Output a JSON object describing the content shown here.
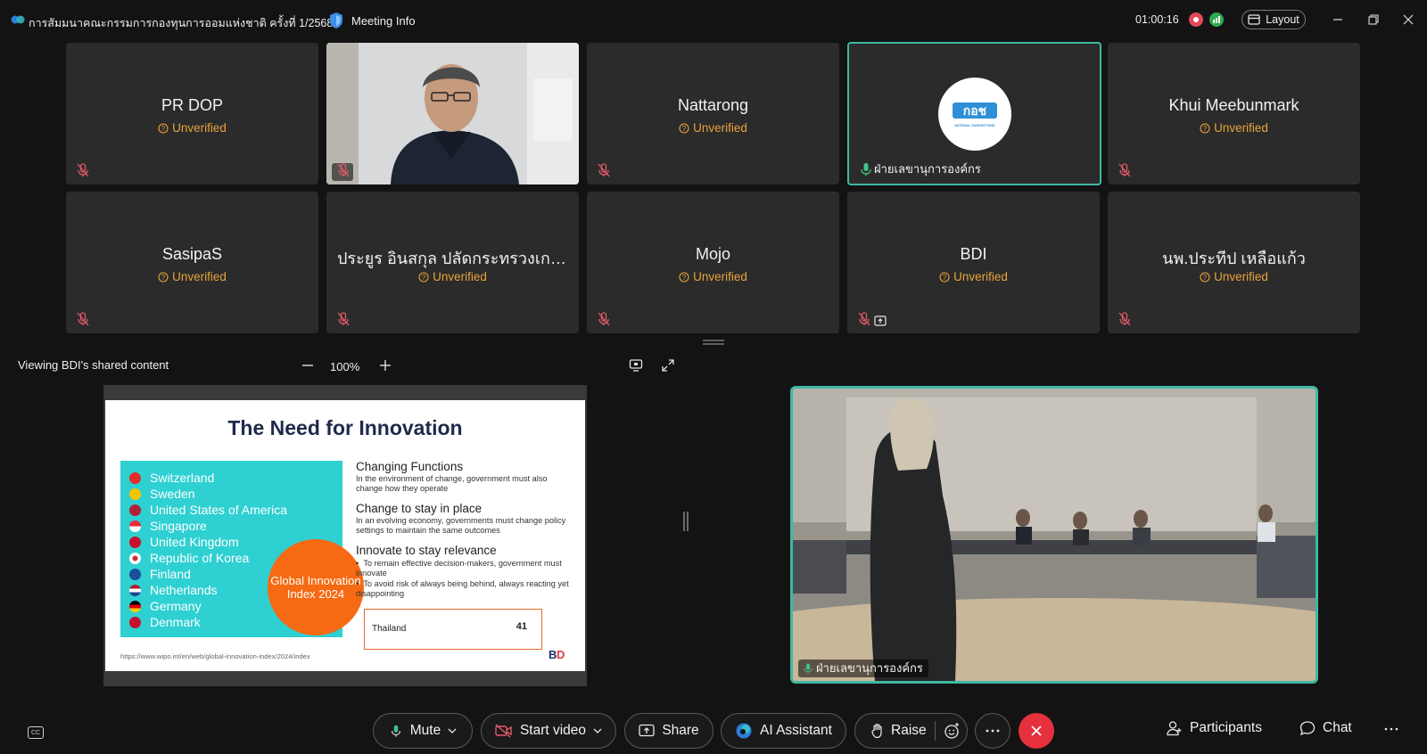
{
  "window": {
    "title": "การสัมมนาคณะกรรมการกองทุนการออมแห่งชาติ ครั้งที่ 1/2568",
    "meeting_info_label": "Meeting Info",
    "timer": "01:00:16",
    "layout_label": "Layout"
  },
  "tiles": [
    {
      "name": "PR DOP",
      "status": "Unverified"
    },
    {
      "name": "",
      "status": ""
    },
    {
      "name": "Nattarong",
      "status": "Unverified"
    },
    {
      "name": "ฝ่ายเลขานุการองค์กร",
      "status": "",
      "logo_text": "NATIONAL SAVINGS FUND"
    },
    {
      "name": "Khui Meebunmark",
      "status": "Unverified"
    },
    {
      "name": "SasipaS",
      "status": "Unverified"
    },
    {
      "name": "ประยูร อินสกุล ปลัดกระทรวงเกษ...",
      "status": "Unverified"
    },
    {
      "name": "Mojo",
      "status": "Unverified"
    },
    {
      "name": "BDI",
      "status": "Unverified"
    },
    {
      "name": "นพ.ประทีป   เหลือแก้ว",
      "status": "Unverified"
    }
  ],
  "share": {
    "viewing_label": "Viewing BDI's shared content",
    "zoom": "100%"
  },
  "slide": {
    "title": "The Need for Innovation",
    "countries": [
      "Switzerland",
      "Sweden",
      "United States of America",
      "Singapore",
      "United Kingdom",
      "Republic of Korea",
      "Finland",
      "Netherlands",
      "Germany",
      "Denmark"
    ],
    "gii_text": "Global Innovation Index 2024",
    "sections": [
      {
        "heading": "Changing Functions",
        "text": "In the environment of change, government must also change how they operate"
      },
      {
        "heading": "Change to stay in place",
        "text": "In an evolving economy, governments must change policy settings to maintain the same outcomes"
      },
      {
        "heading": "Innovate to stay relevance",
        "text": ""
      }
    ],
    "bullets": [
      "To remain effective decision-makers, government must innovate",
      "To avoid risk of always being behind, always reacting yet disappointing"
    ],
    "thailand_label": "Thailand",
    "thailand_rank": "41",
    "url": "https://www.wipo.int/en/web/global-innovation-index/2024/index"
  },
  "video": {
    "name": "ฝ่ายเลขานุการองค์กร"
  },
  "toolbar": {
    "mute": "Mute",
    "start_video": "Start video",
    "share": "Share",
    "ai_assistant": "AI Assistant",
    "raise": "Raise",
    "participants": "Participants",
    "chat": "Chat",
    "cc": "CC"
  },
  "colors": {
    "accent": "#3fb8a3",
    "unverified": "#e7a33a",
    "end_call": "#e5303d",
    "tile_bg": "#2b2b2b"
  }
}
